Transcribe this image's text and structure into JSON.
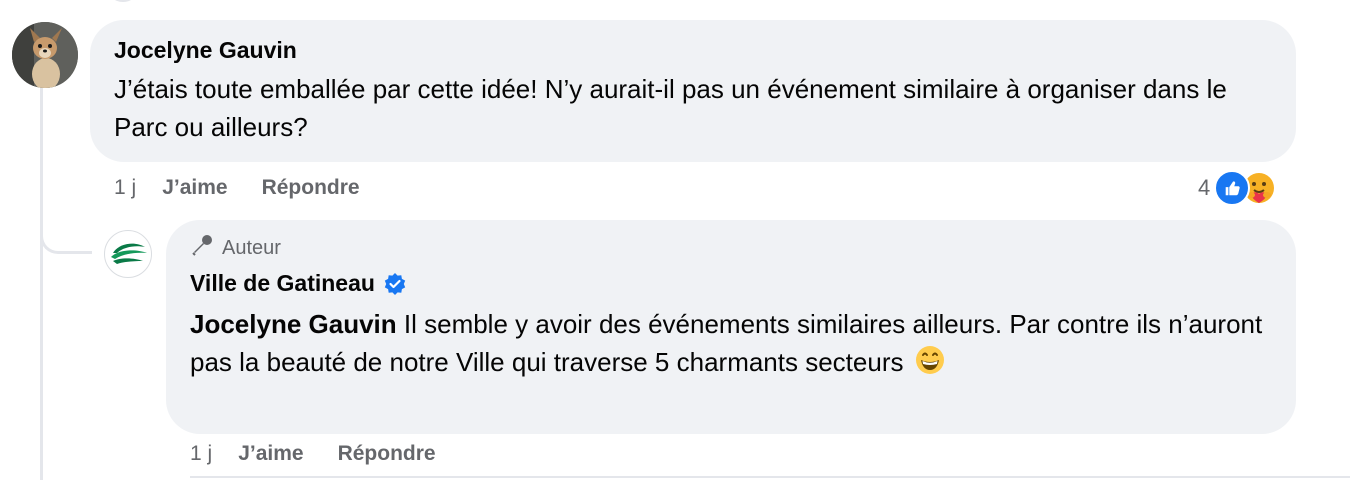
{
  "comment": {
    "author": "Jocelyne Gauvin",
    "text": "J’étais toute emballée par cette idée! N’y aurait-il pas un événement similaire à organiser dans le Parc ou ailleurs?",
    "time": "1 j",
    "like_label": "J’aime",
    "reply_label": "Répondre",
    "reaction_count": "4",
    "reactions": [
      "like-icon",
      "care-icon"
    ]
  },
  "reply": {
    "badge_label": "Auteur",
    "badge_icon": "microphone-icon",
    "author": "Ville de Gatineau",
    "verified_icon": "verified-badge-icon",
    "mention": "Jocelyne Gauvin",
    "text": " Il semble y avoir des événements similaires ailleurs. Par contre ils n’auront pas la beauté de notre Ville qui traverse 5 charmants secteurs ",
    "emoji": "grinning-face-icon",
    "time": "1 j",
    "like_label": "J’aime",
    "reply_label": "Répondre"
  },
  "colors": {
    "bubble": "#f0f2f5",
    "secondary_text": "#65676b",
    "like_blue": "#1877f2",
    "thread_line": "#e4e6eb"
  }
}
